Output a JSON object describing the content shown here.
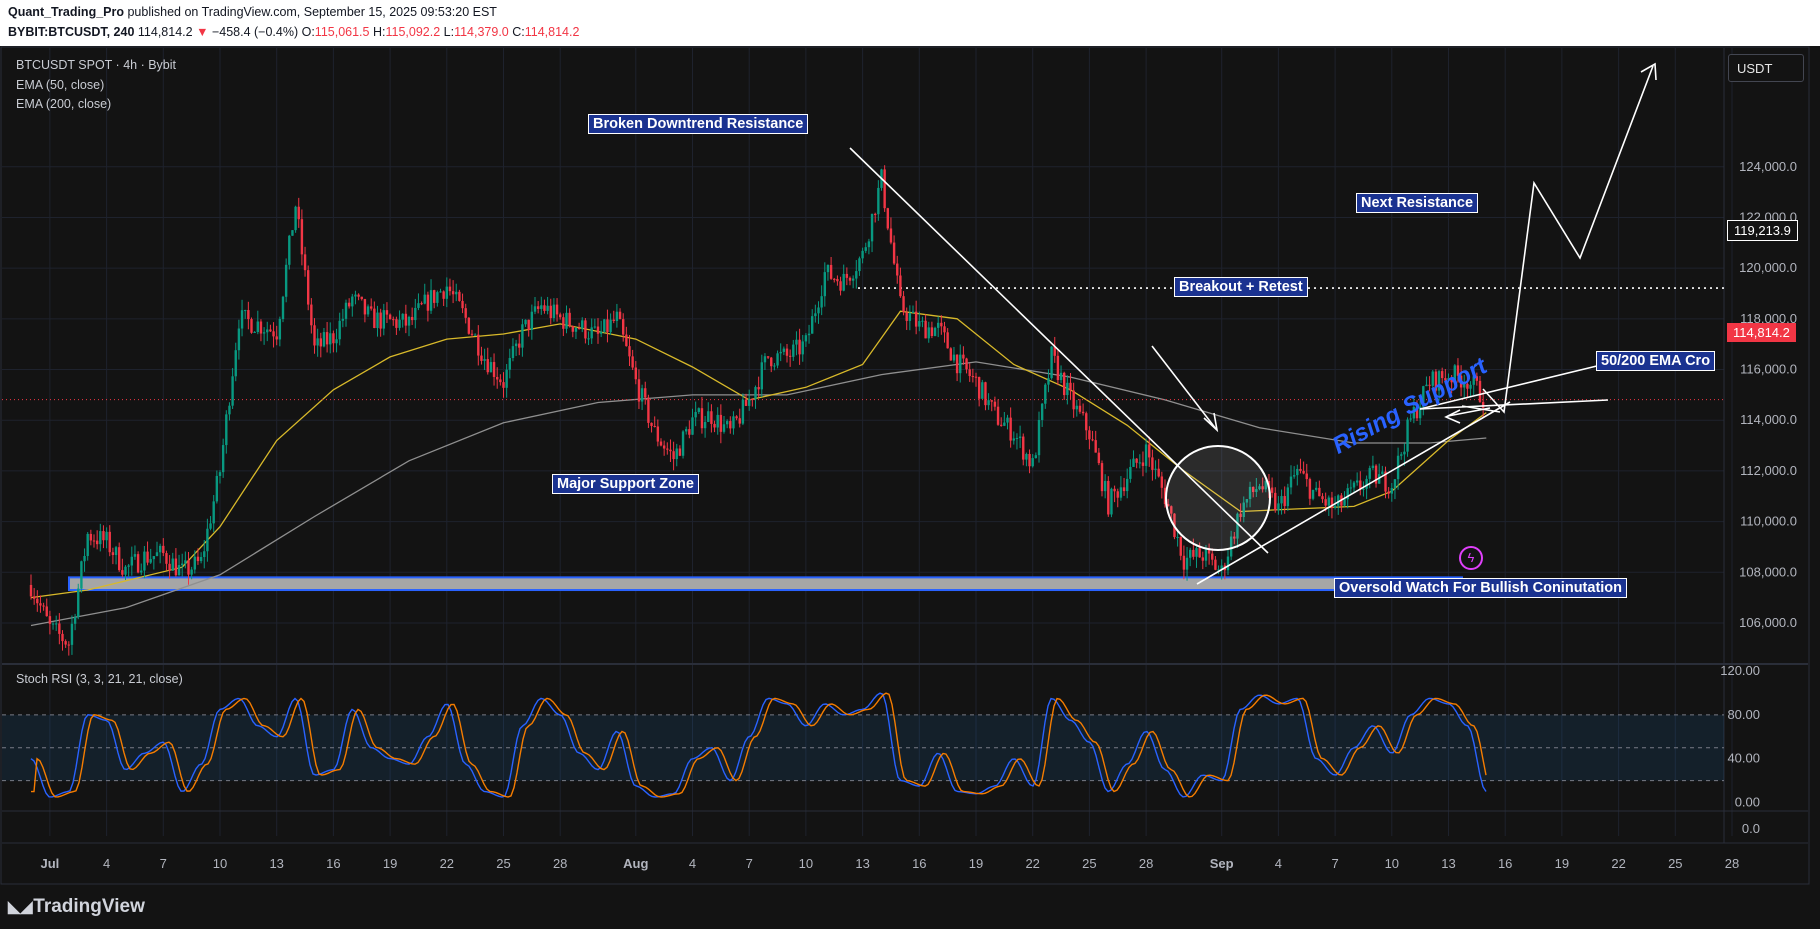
{
  "header": {
    "author": "Quant_Trading_Pro",
    "published": "published on TradingView.com, September 15, 2025 09:53:20 EST",
    "symbol": "BYBIT:BTCUSDT, 240",
    "last": "114,814.2",
    "change": "−458.4 (−0.4%)",
    "o_label": "O:",
    "o": "115,061.5",
    "h_label": "H:",
    "h": "115,092.2",
    "l_label": "L:",
    "l": "114,379.0",
    "c_label": "C:",
    "c": "114,814.2"
  },
  "legend": {
    "title": "BTCUSDT SPOT · 4h · Bybit",
    "ema50": "EMA (50, close)",
    "ema200": "EMA (200, close)",
    "stoch": "Stoch RSI (3, 3, 21, 21, close)"
  },
  "currency": "USDT",
  "annotations": {
    "broken": "Broken Downtrend Resistance",
    "next": "Next Resistance",
    "breakout": "Breakout + Retest",
    "ema_cross": "50/200 EMA Cro",
    "support": "Major Support Zone",
    "rising": "Rising Support",
    "oversold": "Oversold Watch For Bullish Coninutation"
  },
  "price_tags": {
    "resistance": "119,213.9",
    "current": "114,814.2"
  },
  "footer": {
    "logo": "TradingView"
  },
  "colors": {
    "up": "#089981",
    "down": "#f23645",
    "ema50": "#d8b92a",
    "ema200": "#8f8f8f",
    "stoch_k": "#2962ff",
    "stoch_d": "#f57c00",
    "annotation": "#1a3290"
  },
  "chart_data": {
    "type": "candlestick",
    "title": "BTCUSDT SPOT · 4h · Bybit",
    "y_axis": {
      "ticks": [
        "124,000.0",
        "122,000.0",
        "120,000.0",
        "118,000.0",
        "116,000.0",
        "114,000.0",
        "112,000.0",
        "110,000.0",
        "108,000.0",
        "106,000.0"
      ],
      "ylim": [
        104500,
        126200
      ]
    },
    "x_axis": {
      "ticks": [
        "Jul",
        "4",
        "7",
        "10",
        "13",
        "16",
        "19",
        "22",
        "25",
        "28",
        "Aug",
        "4",
        "7",
        "10",
        "13",
        "16",
        "19",
        "22",
        "25",
        "28",
        "Sep",
        "4",
        "7",
        "10",
        "13",
        "16",
        "19",
        "22",
        "25",
        "28"
      ]
    },
    "price_path": [
      [
        "2025-06-30",
        107500
      ],
      [
        "2025-07-01",
        105800
      ],
      [
        "2025-07-02",
        105200
      ],
      [
        "2025-07-03",
        109500
      ],
      [
        "2025-07-04",
        109200
      ],
      [
        "2025-07-05",
        108100
      ],
      [
        "2025-07-06",
        108600
      ],
      [
        "2025-07-07",
        108700
      ],
      [
        "2025-07-08",
        108000
      ],
      [
        "2025-07-09",
        108400
      ],
      [
        "2025-07-10",
        112000
      ],
      [
        "2025-07-11",
        118000
      ],
      [
        "2025-07-12",
        117800
      ],
      [
        "2025-07-13",
        117500
      ],
      [
        "2025-07-14",
        122500
      ],
      [
        "2025-07-15",
        116800
      ],
      [
        "2025-07-16",
        117300
      ],
      [
        "2025-07-17",
        118800
      ],
      [
        "2025-07-18",
        118000
      ],
      [
        "2025-07-19",
        117900
      ],
      [
        "2025-07-20",
        117800
      ],
      [
        "2025-07-21",
        118700
      ],
      [
        "2025-07-22",
        119300
      ],
      [
        "2025-07-23",
        118000
      ],
      [
        "2025-07-24",
        116500
      ],
      [
        "2025-07-25",
        115500
      ],
      [
        "2025-07-26",
        117500
      ],
      [
        "2025-07-27",
        118500
      ],
      [
        "2025-07-28",
        118000
      ],
      [
        "2025-07-29",
        117700
      ],
      [
        "2025-07-30",
        117300
      ],
      [
        "2025-07-31",
        118000
      ],
      [
        "2025-08-01",
        115500
      ],
      [
        "2025-08-02",
        113500
      ],
      [
        "2025-08-03",
        112500
      ],
      [
        "2025-08-04",
        114000
      ],
      [
        "2025-08-05",
        114200
      ],
      [
        "2025-08-06",
        113500
      ],
      [
        "2025-08-07",
        114800
      ],
      [
        "2025-08-08",
        116500
      ],
      [
        "2025-08-09",
        116500
      ],
      [
        "2025-08-10",
        117000
      ],
      [
        "2025-08-11",
        119800
      ],
      [
        "2025-08-12",
        119500
      ],
      [
        "2025-08-13",
        120500
      ],
      [
        "2025-08-14",
        123500
      ],
      [
        "2025-08-15",
        118500
      ],
      [
        "2025-08-16",
        117700
      ],
      [
        "2025-08-17",
        117600
      ],
      [
        "2025-08-18",
        116300
      ],
      [
        "2025-08-19",
        115500
      ],
      [
        "2025-08-20",
        114200
      ],
      [
        "2025-08-21",
        113500
      ],
      [
        "2025-08-22",
        112200
      ],
      [
        "2025-08-23",
        116500
      ],
      [
        "2025-08-24",
        114800
      ],
      [
        "2025-08-25",
        113500
      ],
      [
        "2025-08-26",
        110700
      ],
      [
        "2025-08-27",
        111800
      ],
      [
        "2025-08-28",
        112800
      ],
      [
        "2025-08-29",
        111000
      ],
      [
        "2025-08-30",
        108500
      ],
      [
        "2025-08-31",
        108700
      ],
      [
        "2025-09-01",
        108000
      ],
      [
        "2025-09-02",
        110500
      ],
      [
        "2025-09-03",
        111500
      ],
      [
        "2025-09-04",
        110500
      ],
      [
        "2025-09-05",
        112000
      ],
      [
        "2025-09-06",
        111000
      ],
      [
        "2025-09-07",
        110500
      ],
      [
        "2025-09-08",
        111200
      ],
      [
        "2025-09-09",
        111800
      ],
      [
        "2025-09-10",
        111500
      ],
      [
        "2025-09-11",
        114000
      ],
      [
        "2025-09-12",
        115500
      ],
      [
        "2025-09-13",
        115800
      ],
      [
        "2025-09-14",
        115600
      ],
      [
        "2025-09-15",
        114800
      ]
    ],
    "ema50": [
      [
        "2025-06-30",
        107000
      ],
      [
        "2025-07-03",
        107300
      ],
      [
        "2025-07-08",
        108200
      ],
      [
        "2025-07-10",
        109800
      ],
      [
        "2025-07-13",
        113200
      ],
      [
        "2025-07-16",
        115200
      ],
      [
        "2025-07-19",
        116500
      ],
      [
        "2025-07-22",
        117200
      ],
      [
        "2025-07-25",
        117400
      ],
      [
        "2025-07-28",
        117800
      ],
      [
        "2025-08-01",
        117200
      ],
      [
        "2025-08-04",
        116100
      ],
      [
        "2025-08-07",
        114800
      ],
      [
        "2025-08-10",
        115300
      ],
      [
        "2025-08-13",
        116200
      ],
      [
        "2025-08-15",
        118300
      ],
      [
        "2025-08-18",
        118000
      ],
      [
        "2025-08-21",
        116200
      ],
      [
        "2025-08-24",
        115200
      ],
      [
        "2025-08-27",
        113800
      ],
      [
        "2025-08-30",
        112000
      ],
      [
        "2025-09-02",
        110400
      ],
      [
        "2025-09-05",
        110500
      ],
      [
        "2025-09-08",
        110600
      ],
      [
        "2025-09-10",
        111200
      ],
      [
        "2025-09-13",
        113200
      ],
      [
        "2025-09-15",
        114300
      ]
    ],
    "ema200": [
      [
        "2025-06-30",
        105900
      ],
      [
        "2025-07-05",
        106600
      ],
      [
        "2025-07-10",
        107900
      ],
      [
        "2025-07-15",
        110200
      ],
      [
        "2025-07-20",
        112400
      ],
      [
        "2025-07-25",
        113900
      ],
      [
        "2025-07-30",
        114700
      ],
      [
        "2025-08-04",
        115000
      ],
      [
        "2025-08-09",
        115000
      ],
      [
        "2025-08-14",
        115800
      ],
      [
        "2025-08-19",
        116300
      ],
      [
        "2025-08-24",
        115700
      ],
      [
        "2025-08-29",
        114800
      ],
      [
        "2025-09-03",
        113700
      ],
      [
        "2025-09-08",
        113100
      ],
      [
        "2025-09-12",
        113100
      ],
      [
        "2025-09-15",
        113300
      ]
    ],
    "support_zone": [
      107300,
      107800
    ],
    "stoch_rsi": {
      "ticks": [
        "120.00",
        "80.00",
        "40.00",
        "0.00"
      ],
      "bands": [
        20,
        80
      ],
      "ylim": [
        -5,
        120
      ],
      "k": [
        [
          "2025-06-30",
          40
        ],
        [
          "2025-07-01",
          5
        ],
        [
          "2025-07-02",
          10
        ],
        [
          "2025-07-03",
          80
        ],
        [
          "2025-07-04",
          75
        ],
        [
          "2025-07-05",
          30
        ],
        [
          "2025-07-06",
          45
        ],
        [
          "2025-07-07",
          55
        ],
        [
          "2025-07-08",
          10
        ],
        [
          "2025-07-09",
          35
        ],
        [
          "2025-07-10",
          85
        ],
        [
          "2025-07-11",
          95
        ],
        [
          "2025-07-12",
          70
        ],
        [
          "2025-07-13",
          60
        ],
        [
          "2025-07-14",
          95
        ],
        [
          "2025-07-15",
          25
        ],
        [
          "2025-07-16",
          30
        ],
        [
          "2025-07-17",
          85
        ],
        [
          "2025-07-18",
          50
        ],
        [
          "2025-07-19",
          40
        ],
        [
          "2025-07-20",
          35
        ],
        [
          "2025-07-21",
          60
        ],
        [
          "2025-07-22",
          90
        ],
        [
          "2025-07-23",
          35
        ],
        [
          "2025-07-24",
          10
        ],
        [
          "2025-07-25",
          5
        ],
        [
          "2025-07-26",
          70
        ],
        [
          "2025-07-27",
          95
        ],
        [
          "2025-07-28",
          80
        ],
        [
          "2025-07-29",
          45
        ],
        [
          "2025-07-30",
          30
        ],
        [
          "2025-07-31",
          65
        ],
        [
          "2025-08-01",
          15
        ],
        [
          "2025-08-02",
          5
        ],
        [
          "2025-08-03",
          8
        ],
        [
          "2025-08-04",
          40
        ],
        [
          "2025-08-05",
          50
        ],
        [
          "2025-08-06",
          20
        ],
        [
          "2025-08-07",
          60
        ],
        [
          "2025-08-08",
          95
        ],
        [
          "2025-08-09",
          90
        ],
        [
          "2025-08-10",
          70
        ],
        [
          "2025-08-11",
          90
        ],
        [
          "2025-08-12",
          80
        ],
        [
          "2025-08-13",
          85
        ],
        [
          "2025-08-14",
          100
        ],
        [
          "2025-08-15",
          20
        ],
        [
          "2025-08-16",
          15
        ],
        [
          "2025-08-17",
          45
        ],
        [
          "2025-08-18",
          10
        ],
        [
          "2025-08-19",
          8
        ],
        [
          "2025-08-20",
          15
        ],
        [
          "2025-08-21",
          40
        ],
        [
          "2025-08-22",
          15
        ],
        [
          "2025-08-23",
          95
        ],
        [
          "2025-08-24",
          75
        ],
        [
          "2025-08-25",
          55
        ],
        [
          "2025-08-26",
          10
        ],
        [
          "2025-08-27",
          35
        ],
        [
          "2025-08-28",
          65
        ],
        [
          "2025-08-29",
          30
        ],
        [
          "2025-08-30",
          5
        ],
        [
          "2025-08-31",
          25
        ],
        [
          "2025-09-01",
          20
        ],
        [
          "2025-09-02",
          85
        ],
        [
          "2025-09-03",
          98
        ],
        [
          "2025-09-04",
          90
        ],
        [
          "2025-09-05",
          95
        ],
        [
          "2025-09-06",
          40
        ],
        [
          "2025-09-07",
          25
        ],
        [
          "2025-09-08",
          50
        ],
        [
          "2025-09-09",
          70
        ],
        [
          "2025-09-10",
          45
        ],
        [
          "2025-09-11",
          80
        ],
        [
          "2025-09-12",
          95
        ],
        [
          "2025-09-13",
          90
        ],
        [
          "2025-09-14",
          70
        ],
        [
          "2025-09-15",
          10
        ]
      ]
    }
  }
}
